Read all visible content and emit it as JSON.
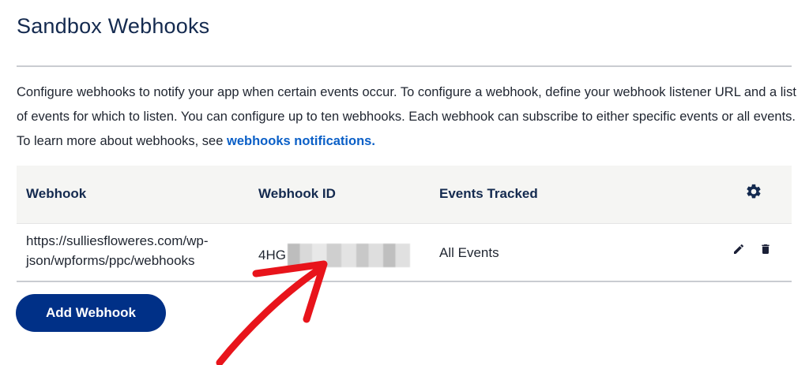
{
  "page": {
    "title": "Sandbox Webhooks",
    "description_text": "Configure webhooks to notify your app when certain events occur. To configure a webhook, define your webhook listener URL and a list of events for which to listen. You can configure up to ten webhooks. Each webhook can subscribe to either specific events or all events. To learn more about webhooks, see ",
    "description_link": "webhooks notifications."
  },
  "table": {
    "headers": {
      "webhook": "Webhook",
      "webhook_id": "Webhook ID",
      "events_tracked": "Events Tracked"
    },
    "rows": [
      {
        "url": "https://sulliesfloweres.com/wp-json/wpforms/ppc/webhooks",
        "id_visible_prefix": "4HG",
        "events": "All Events"
      }
    ]
  },
  "actions": {
    "add_label": "Add Webhook"
  },
  "icons": {
    "header": "gear-icon",
    "row": [
      "pencil-icon",
      "trash-icon"
    ]
  },
  "colors": {
    "primary_button": "#003087",
    "link": "#0a5fc7",
    "annotation_arrow": "#e8141b"
  }
}
